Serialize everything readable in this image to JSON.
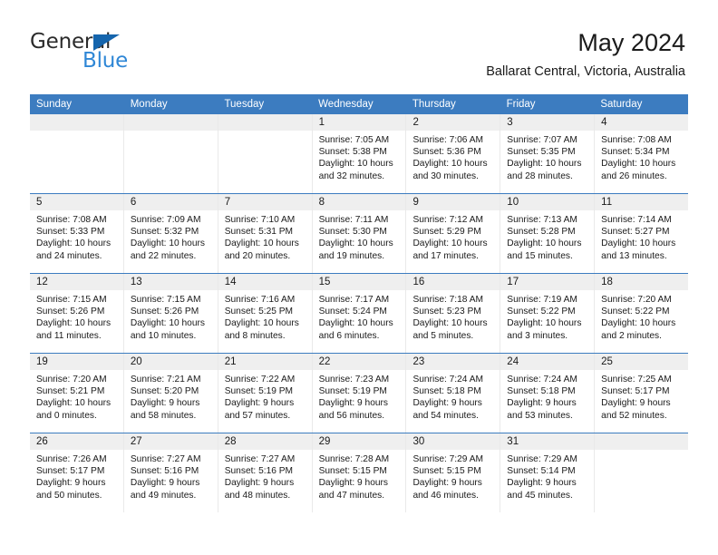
{
  "brand": {
    "word_one": "General",
    "word_two": "Blue",
    "triangle_color": "#1565ad",
    "blue_color": "#2f87d6"
  },
  "header": {
    "title": "May 2024",
    "subtitle": "Ballarat Central, Victoria, Australia"
  },
  "theme": {
    "header_blue": "#3c7cc0",
    "day_band_gray": "#efefef",
    "cell_border": "#e9e9e9"
  },
  "weekdays": [
    "Sunday",
    "Monday",
    "Tuesday",
    "Wednesday",
    "Thursday",
    "Friday",
    "Saturday"
  ],
  "weeks": [
    [
      {
        "day": "",
        "sunrise": "",
        "sunset": "",
        "daylight": "",
        "empty": true
      },
      {
        "day": "",
        "sunrise": "",
        "sunset": "",
        "daylight": "",
        "empty": true
      },
      {
        "day": "",
        "sunrise": "",
        "sunset": "",
        "daylight": "",
        "empty": true
      },
      {
        "day": "1",
        "sunrise": "Sunrise: 7:05 AM",
        "sunset": "Sunset: 5:38 PM",
        "daylight": "Daylight: 10 hours and 32 minutes."
      },
      {
        "day": "2",
        "sunrise": "Sunrise: 7:06 AM",
        "sunset": "Sunset: 5:36 PM",
        "daylight": "Daylight: 10 hours and 30 minutes."
      },
      {
        "day": "3",
        "sunrise": "Sunrise: 7:07 AM",
        "sunset": "Sunset: 5:35 PM",
        "daylight": "Daylight: 10 hours and 28 minutes."
      },
      {
        "day": "4",
        "sunrise": "Sunrise: 7:08 AM",
        "sunset": "Sunset: 5:34 PM",
        "daylight": "Daylight: 10 hours and 26 minutes."
      }
    ],
    [
      {
        "day": "5",
        "sunrise": "Sunrise: 7:08 AM",
        "sunset": "Sunset: 5:33 PM",
        "daylight": "Daylight: 10 hours and 24 minutes."
      },
      {
        "day": "6",
        "sunrise": "Sunrise: 7:09 AM",
        "sunset": "Sunset: 5:32 PM",
        "daylight": "Daylight: 10 hours and 22 minutes."
      },
      {
        "day": "7",
        "sunrise": "Sunrise: 7:10 AM",
        "sunset": "Sunset: 5:31 PM",
        "daylight": "Daylight: 10 hours and 20 minutes."
      },
      {
        "day": "8",
        "sunrise": "Sunrise: 7:11 AM",
        "sunset": "Sunset: 5:30 PM",
        "daylight": "Daylight: 10 hours and 19 minutes."
      },
      {
        "day": "9",
        "sunrise": "Sunrise: 7:12 AM",
        "sunset": "Sunset: 5:29 PM",
        "daylight": "Daylight: 10 hours and 17 minutes."
      },
      {
        "day": "10",
        "sunrise": "Sunrise: 7:13 AM",
        "sunset": "Sunset: 5:28 PM",
        "daylight": "Daylight: 10 hours and 15 minutes."
      },
      {
        "day": "11",
        "sunrise": "Sunrise: 7:14 AM",
        "sunset": "Sunset: 5:27 PM",
        "daylight": "Daylight: 10 hours and 13 minutes."
      }
    ],
    [
      {
        "day": "12",
        "sunrise": "Sunrise: 7:15 AM",
        "sunset": "Sunset: 5:26 PM",
        "daylight": "Daylight: 10 hours and 11 minutes."
      },
      {
        "day": "13",
        "sunrise": "Sunrise: 7:15 AM",
        "sunset": "Sunset: 5:26 PM",
        "daylight": "Daylight: 10 hours and 10 minutes."
      },
      {
        "day": "14",
        "sunrise": "Sunrise: 7:16 AM",
        "sunset": "Sunset: 5:25 PM",
        "daylight": "Daylight: 10 hours and 8 minutes."
      },
      {
        "day": "15",
        "sunrise": "Sunrise: 7:17 AM",
        "sunset": "Sunset: 5:24 PM",
        "daylight": "Daylight: 10 hours and 6 minutes."
      },
      {
        "day": "16",
        "sunrise": "Sunrise: 7:18 AM",
        "sunset": "Sunset: 5:23 PM",
        "daylight": "Daylight: 10 hours and 5 minutes."
      },
      {
        "day": "17",
        "sunrise": "Sunrise: 7:19 AM",
        "sunset": "Sunset: 5:22 PM",
        "daylight": "Daylight: 10 hours and 3 minutes."
      },
      {
        "day": "18",
        "sunrise": "Sunrise: 7:20 AM",
        "sunset": "Sunset: 5:22 PM",
        "daylight": "Daylight: 10 hours and 2 minutes."
      }
    ],
    [
      {
        "day": "19",
        "sunrise": "Sunrise: 7:20 AM",
        "sunset": "Sunset: 5:21 PM",
        "daylight": "Daylight: 10 hours and 0 minutes."
      },
      {
        "day": "20",
        "sunrise": "Sunrise: 7:21 AM",
        "sunset": "Sunset: 5:20 PM",
        "daylight": "Daylight: 9 hours and 58 minutes."
      },
      {
        "day": "21",
        "sunrise": "Sunrise: 7:22 AM",
        "sunset": "Sunset: 5:19 PM",
        "daylight": "Daylight: 9 hours and 57 minutes."
      },
      {
        "day": "22",
        "sunrise": "Sunrise: 7:23 AM",
        "sunset": "Sunset: 5:19 PM",
        "daylight": "Daylight: 9 hours and 56 minutes."
      },
      {
        "day": "23",
        "sunrise": "Sunrise: 7:24 AM",
        "sunset": "Sunset: 5:18 PM",
        "daylight": "Daylight: 9 hours and 54 minutes."
      },
      {
        "day": "24",
        "sunrise": "Sunrise: 7:24 AM",
        "sunset": "Sunset: 5:18 PM",
        "daylight": "Daylight: 9 hours and 53 minutes."
      },
      {
        "day": "25",
        "sunrise": "Sunrise: 7:25 AM",
        "sunset": "Sunset: 5:17 PM",
        "daylight": "Daylight: 9 hours and 52 minutes."
      }
    ],
    [
      {
        "day": "26",
        "sunrise": "Sunrise: 7:26 AM",
        "sunset": "Sunset: 5:17 PM",
        "daylight": "Daylight: 9 hours and 50 minutes."
      },
      {
        "day": "27",
        "sunrise": "Sunrise: 7:27 AM",
        "sunset": "Sunset: 5:16 PM",
        "daylight": "Daylight: 9 hours and 49 minutes."
      },
      {
        "day": "28",
        "sunrise": "Sunrise: 7:27 AM",
        "sunset": "Sunset: 5:16 PM",
        "daylight": "Daylight: 9 hours and 48 minutes."
      },
      {
        "day": "29",
        "sunrise": "Sunrise: 7:28 AM",
        "sunset": "Sunset: 5:15 PM",
        "daylight": "Daylight: 9 hours and 47 minutes."
      },
      {
        "day": "30",
        "sunrise": "Sunrise: 7:29 AM",
        "sunset": "Sunset: 5:15 PM",
        "daylight": "Daylight: 9 hours and 46 minutes."
      },
      {
        "day": "31",
        "sunrise": "Sunrise: 7:29 AM",
        "sunset": "Sunset: 5:14 PM",
        "daylight": "Daylight: 9 hours and 45 minutes."
      },
      {
        "day": "",
        "sunrise": "",
        "sunset": "",
        "daylight": "",
        "empty": true
      }
    ]
  ]
}
